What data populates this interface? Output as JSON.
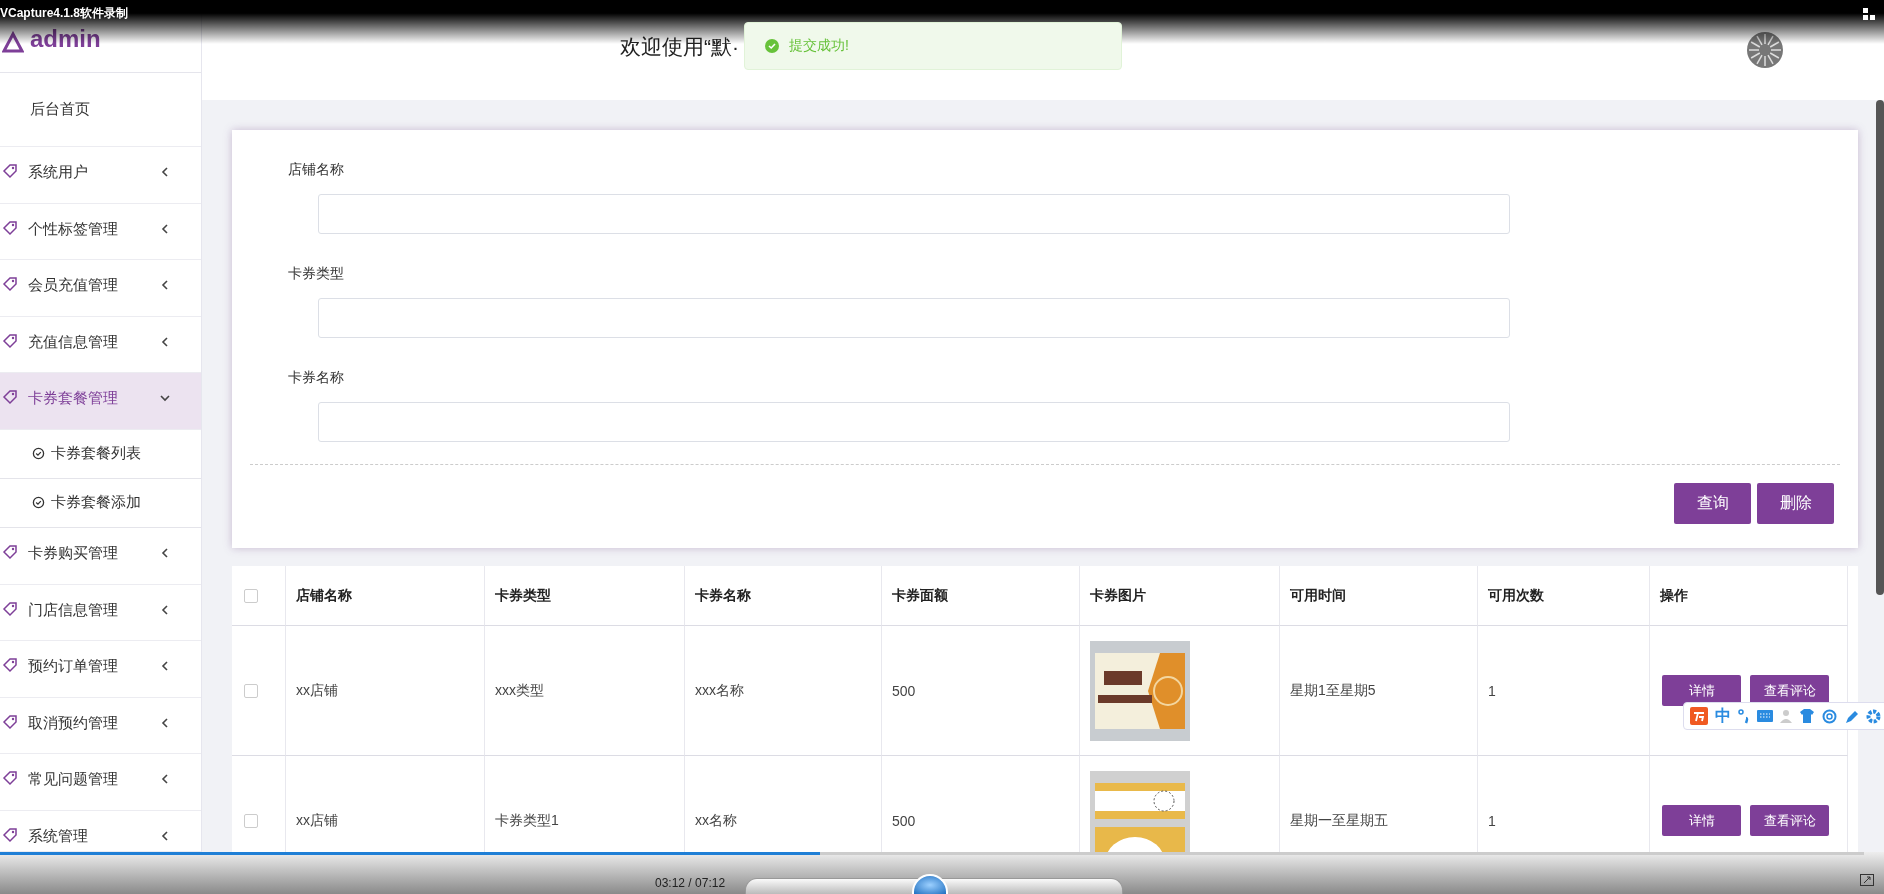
{
  "recorder": {
    "title": "VCapture4.1.8软件录制"
  },
  "sidebar": {
    "logo": "admin",
    "items": [
      {
        "label": "后台首页",
        "kind": "plain",
        "expanded": false
      },
      {
        "label": "系统用户",
        "kind": "group",
        "expanded": false
      },
      {
        "label": "个性标签管理",
        "kind": "group",
        "expanded": false
      },
      {
        "label": "会员充值管理",
        "kind": "group",
        "expanded": false
      },
      {
        "label": "充值信息管理",
        "kind": "group",
        "expanded": false
      },
      {
        "label": "卡券套餐管理",
        "kind": "group",
        "expanded": true,
        "children": [
          {
            "label": "卡券套餐列表"
          },
          {
            "label": "卡券套餐添加"
          }
        ]
      },
      {
        "label": "卡券购买管理",
        "kind": "group",
        "expanded": false
      },
      {
        "label": "门店信息管理",
        "kind": "group",
        "expanded": false
      },
      {
        "label": "预约订单管理",
        "kind": "group",
        "expanded": false
      },
      {
        "label": "取消预约管理",
        "kind": "group",
        "expanded": false
      },
      {
        "label": "常见问题管理",
        "kind": "group",
        "expanded": false
      },
      {
        "label": "系统管理",
        "kind": "group",
        "expanded": false
      }
    ]
  },
  "header": {
    "welcome": "欢迎使用“默·"
  },
  "toast": {
    "message": "提交成功!"
  },
  "search_form": {
    "fields": [
      {
        "label": "店铺名称"
      },
      {
        "label": "卡券类型"
      },
      {
        "label": "卡券名称"
      }
    ],
    "buttons": [
      "查询",
      "删除"
    ]
  },
  "table": {
    "select_all_checked": false,
    "columns": [
      "店铺名称",
      "卡券类型",
      "卡券名称",
      "卡券面额",
      "卡券图片",
      "可用时间",
      "可用次数",
      "操作"
    ],
    "rows": [
      {
        "checked": false,
        "shop": "xx店铺",
        "type": "xxx类型",
        "name": "xxx名称",
        "amount": "500",
        "image": {
          "kind": "picture"
        },
        "time": "星期1至星期5",
        "uses": "1",
        "actions": [
          "详情",
          "查看评论"
        ]
      },
      {
        "checked": false,
        "shop": "xx店铺",
        "type": "卡券类型1",
        "name": "xx名称",
        "amount": "500",
        "image": {
          "kind": "picture"
        },
        "time": "星期一至星期五",
        "uses": "1",
        "actions": [
          "详情",
          "查看评论"
        ]
      }
    ]
  },
  "ime_toolbar": {
    "mode": "中"
  },
  "player": {
    "time": "03:12 / 07:12",
    "progress": {
      "level": 0.44
    }
  }
}
